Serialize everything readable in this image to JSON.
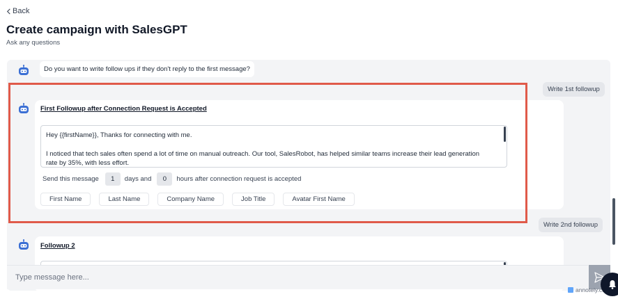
{
  "header": {
    "back_label": "Back",
    "title": "Create campaign with SalesGPT",
    "subtitle": "Ask any questions"
  },
  "chat": {
    "question": "Do you want to write follow ups if they don't reply to the first message?",
    "user_replies": {
      "first": "Write 1st followup",
      "second": "Write 2nd followup"
    },
    "followup1": {
      "title": "First Followup after Connection Request is Accepted",
      "body_line1": "Hey {{firstName}}, Thanks for connecting with me.",
      "body_line2": "I noticed that tech sales often spend a lot of time on manual outreach. Our tool, SalesRobot, has helped similar teams increase their lead generation rate by 35%, with less effort.",
      "send_label": "Send this message",
      "days_value": "1",
      "days_label": "days and",
      "hours_value": "0",
      "hours_label": "hours after connection request is accepted",
      "variables": [
        "First Name",
        "Last Name",
        "Company Name",
        "Job Title",
        "Avatar First Name"
      ]
    },
    "followup2": {
      "title": "Followup 2"
    }
  },
  "composer": {
    "placeholder": "Type message here..."
  },
  "watermark": "annotely.com",
  "colors": {
    "highlight": "#e05a4a",
    "bot_icon": "#3b6fd4"
  }
}
